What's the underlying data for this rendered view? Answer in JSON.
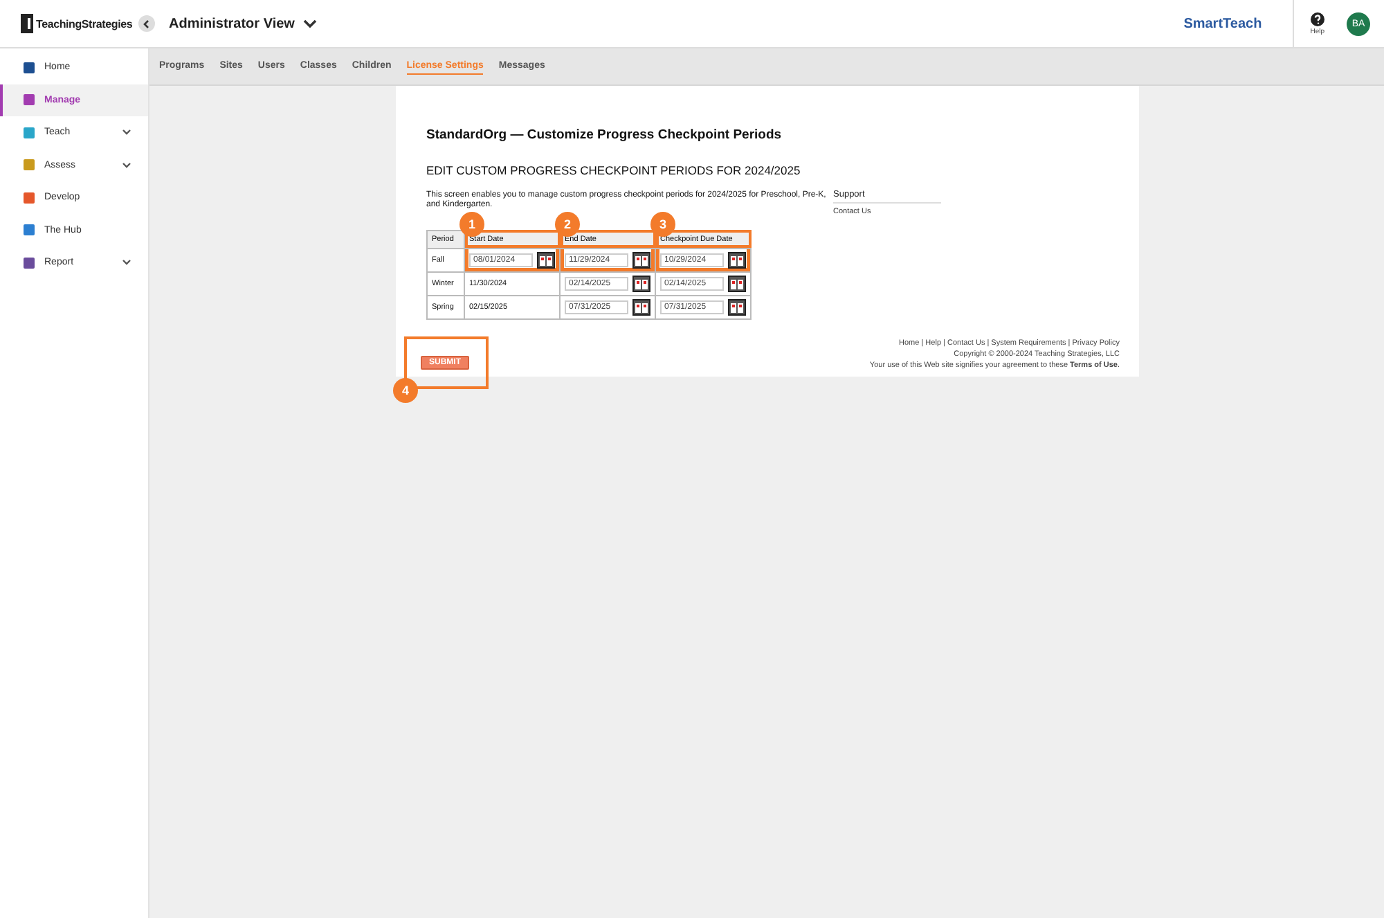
{
  "header": {
    "brand": "TeachingStrategies",
    "view_title": "Administrator View",
    "product": "SmartTeach",
    "help": "Help",
    "avatar": "BA"
  },
  "sidebar": {
    "items": [
      {
        "label": "Home",
        "selected": false,
        "expandable": false
      },
      {
        "label": "Manage",
        "selected": true,
        "expandable": false
      },
      {
        "label": "Teach",
        "selected": false,
        "expandable": true
      },
      {
        "label": "Assess",
        "selected": false,
        "expandable": true
      },
      {
        "label": "Develop",
        "selected": false,
        "expandable": false
      },
      {
        "label": "The Hub",
        "selected": false,
        "expandable": false
      },
      {
        "label": "Report",
        "selected": false,
        "expandable": true
      }
    ]
  },
  "tabs": [
    {
      "label": "Programs",
      "selected": false
    },
    {
      "label": "Sites",
      "selected": false
    },
    {
      "label": "Users",
      "selected": false
    },
    {
      "label": "Classes",
      "selected": false
    },
    {
      "label": "Children",
      "selected": false
    },
    {
      "label": "License Settings",
      "selected": true
    },
    {
      "label": "Messages",
      "selected": false
    }
  ],
  "page": {
    "title": "StandardOrg — Customize Progress Checkpoint Periods",
    "subtitle": "EDIT CUSTOM PROGRESS CHECKPOINT PERIODS FOR 2024/2025",
    "description": "This screen enables you to manage custom progress checkpoint periods for 2024/2025 for Preschool, Pre-K, and Kindergarten.",
    "table": {
      "columns": [
        {
          "label": "Period"
        },
        {
          "label": "Start Date",
          "callout": "1"
        },
        {
          "label": "End Date",
          "callout": "2"
        },
        {
          "label": "Checkpoint Due Date",
          "callout": "3"
        }
      ],
      "rows": [
        {
          "cells": [
            {
              "kind": "text",
              "value": "Fall"
            },
            {
              "kind": "input",
              "value": "08/01/2024"
            },
            {
              "kind": "input",
              "value": "11/29/2024"
            },
            {
              "kind": "input",
              "value": "10/29/2024"
            }
          ]
        },
        {
          "cells": [
            {
              "kind": "text",
              "value": "Winter"
            },
            {
              "kind": "text",
              "value": "11/30/2024"
            },
            {
              "kind": "input",
              "value": "02/14/2025"
            },
            {
              "kind": "input",
              "value": "02/14/2025"
            }
          ]
        },
        {
          "cells": [
            {
              "kind": "text",
              "value": "Spring"
            },
            {
              "kind": "text",
              "value": "02/15/2025"
            },
            {
              "kind": "input",
              "value": "07/31/2025"
            },
            {
              "kind": "input",
              "value": "07/31/2025"
            }
          ]
        }
      ]
    },
    "submit": {
      "label": "SUBMIT",
      "callout": "4"
    },
    "support": {
      "title": "Support",
      "link": "Contact Us"
    },
    "footer": {
      "links": "Home | Help | Contact Us | System Requirements | Privacy Policy",
      "copyright": "Copyright © 2000-2024 Teaching Strategies, LLC",
      "agreement": "Your use of this Web site signifies your agreement to these **Terms of Use**."
    }
  }
}
